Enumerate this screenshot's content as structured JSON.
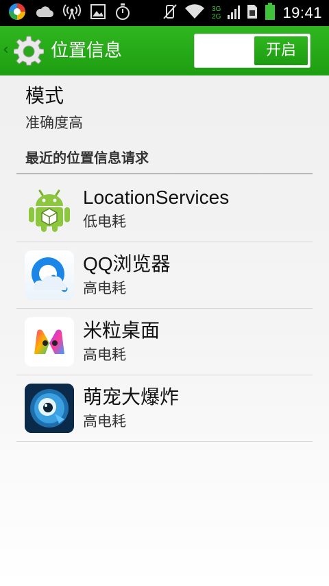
{
  "status_bar": {
    "time": "19:41",
    "network_top": "3G",
    "network_bottom": "2G",
    "icons": [
      "app-notification-icon",
      "cloud-icon",
      "hotspot-icon",
      "image-icon",
      "timer-icon",
      "vibrate-off-icon",
      "wifi-icon",
      "signal-icon",
      "sim-icon",
      "battery-icon"
    ]
  },
  "action_bar": {
    "title": "位置信息",
    "toggle_label": "开启",
    "toggle_on": true,
    "accent_color": "#25a817"
  },
  "mode": {
    "title": "模式",
    "value": "准确度高"
  },
  "recent_requests": {
    "header": "最近的位置信息请求",
    "items": [
      {
        "name": "LocationServices",
        "power": "低电耗",
        "icon": "android-robot-icon"
      },
      {
        "name": "QQ浏览器",
        "power": "高电耗",
        "icon": "qq-browser-icon"
      },
      {
        "name": "米粒桌面",
        "power": "高电耗",
        "icon": "mili-launcher-icon"
      },
      {
        "name": "萌宠大爆炸",
        "power": "高电耗",
        "icon": "pet-game-icon"
      }
    ]
  }
}
